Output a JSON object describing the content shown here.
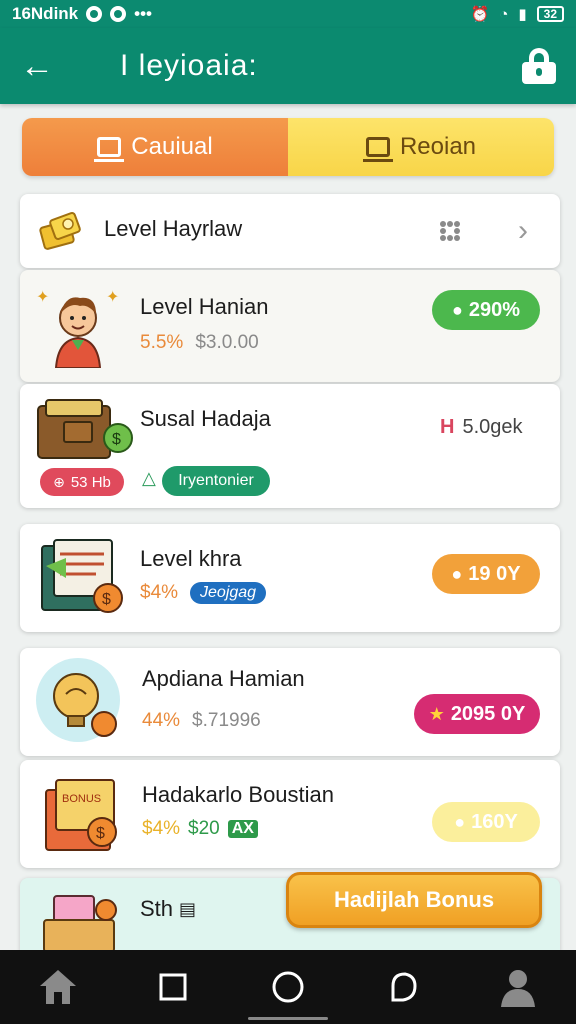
{
  "status_bar": {
    "time": "16Ndink",
    "battery": "32"
  },
  "app_bar": {
    "title": "I leyioaia:"
  },
  "segments": {
    "casual": "Cauiual",
    "region": "Reoian"
  },
  "header_row": {
    "label": "Level Hayrlaw"
  },
  "items": [
    {
      "title": "Level Hanian",
      "pct": "5.5%",
      "amount": "$3.0.00",
      "badge": "290%",
      "badge_color": "#4cb84d"
    },
    {
      "title": "Susal Hadaja",
      "tag_red": "53 Hb",
      "tag_green": "Iryentonier",
      "side": "5.0gek",
      "side_color": "#d9465f"
    },
    {
      "title": "Level khra",
      "pct": "$4%",
      "tag_blue": "Jeojgag",
      "badge": "19 0Y",
      "badge_color": "#f2a13a"
    },
    {
      "title": "Apdiana Hamian",
      "pct": "44%",
      "amount": "$.71996",
      "badge": "2095 0Y",
      "badge_color": "#d62c72"
    },
    {
      "title": "Hadakarlo Boustian",
      "pct": "$4%",
      "amount": "$20",
      "tag_green": "AX",
      "badge": "160Y",
      "badge_color": "#fbef9c"
    },
    {
      "title": "Sth",
      "bonus": "Hadijlah Bonus"
    }
  ],
  "colors": {
    "primary": "#0b8a6f",
    "orange": "#ee7f3a",
    "yellow": "#f8d548"
  }
}
